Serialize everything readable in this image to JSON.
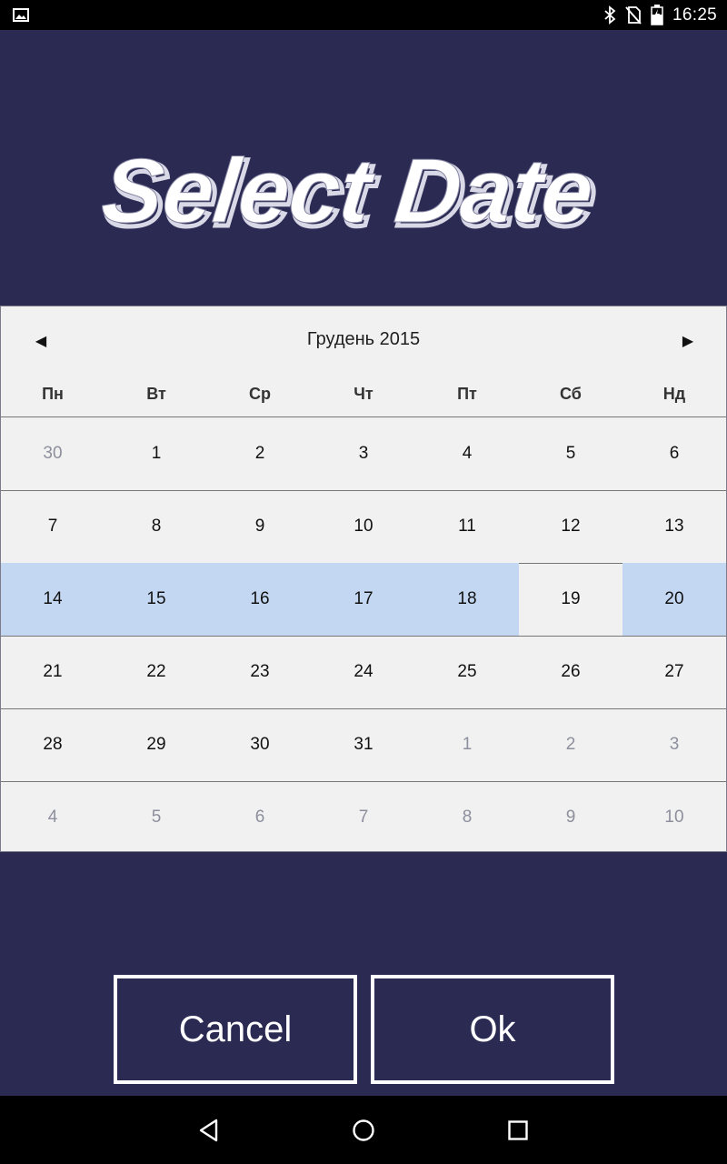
{
  "status_bar": {
    "time": "16:25",
    "icons": [
      "image-icon",
      "bluetooth-icon",
      "no-sim-icon",
      "battery-charging-icon"
    ]
  },
  "header": {
    "title": "Select Date"
  },
  "calendar": {
    "month_label": "Грудень 2015",
    "prev_symbol": "◀",
    "next_symbol": "▶",
    "weekdays": [
      "Пн",
      "Вт",
      "Ср",
      "Чт",
      "Пт",
      "Сб",
      "Нд"
    ],
    "weeks": [
      [
        {
          "d": "30",
          "o": true
        },
        {
          "d": "1"
        },
        {
          "d": "2"
        },
        {
          "d": "3"
        },
        {
          "d": "4"
        },
        {
          "d": "5"
        },
        {
          "d": "6"
        }
      ],
      [
        {
          "d": "7"
        },
        {
          "d": "8"
        },
        {
          "d": "9"
        },
        {
          "d": "10"
        },
        {
          "d": "11"
        },
        {
          "d": "12"
        },
        {
          "d": "13"
        }
      ],
      [
        {
          "d": "14",
          "s": true
        },
        {
          "d": "15",
          "s": true
        },
        {
          "d": "16",
          "s": true
        },
        {
          "d": "17",
          "s": true
        },
        {
          "d": "18",
          "s": true
        },
        {
          "d": "19"
        },
        {
          "d": "20",
          "s": true
        }
      ],
      [
        {
          "d": "21"
        },
        {
          "d": "22"
        },
        {
          "d": "23"
        },
        {
          "d": "24"
        },
        {
          "d": "25"
        },
        {
          "d": "26"
        },
        {
          "d": "27"
        }
      ],
      [
        {
          "d": "28"
        },
        {
          "d": "29"
        },
        {
          "d": "30"
        },
        {
          "d": "31"
        },
        {
          "d": "1",
          "o": true
        },
        {
          "d": "2",
          "o": true
        },
        {
          "d": "3",
          "o": true
        }
      ],
      [
        {
          "d": "4",
          "o": true
        },
        {
          "d": "5",
          "o": true
        },
        {
          "d": "6",
          "o": true
        },
        {
          "d": "7",
          "o": true
        },
        {
          "d": "8",
          "o": true
        },
        {
          "d": "9",
          "o": true
        },
        {
          "d": "10",
          "o": true
        }
      ]
    ]
  },
  "buttons": {
    "cancel_label": "Cancel",
    "ok_label": "Ok"
  },
  "nav_bar": {
    "icons": [
      "back-icon",
      "home-icon",
      "recents-icon"
    ]
  },
  "colors": {
    "background": "#2b2a53",
    "calendar_bg": "#f1f1f1",
    "selected": "#c4d7f2"
  }
}
